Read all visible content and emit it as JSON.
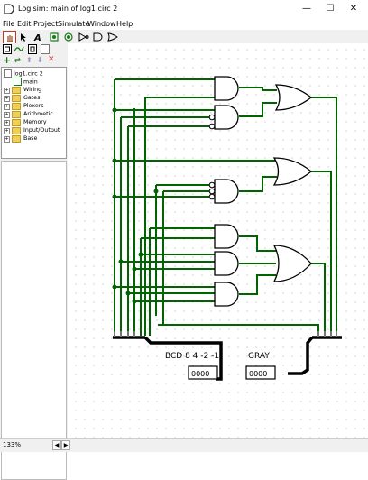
{
  "window": {
    "title": "Logisim: main of log1.circ 2",
    "minimize": "—",
    "maximize": "☐",
    "close": "✕"
  },
  "menu": [
    "File",
    "Edit",
    "Project",
    "Simulate",
    "Window",
    "Help"
  ],
  "project_tree": {
    "root": "log1.circ 2",
    "circuit": "main",
    "libraries": [
      "Wiring",
      "Gates",
      "Plexers",
      "Arithmetic",
      "Memory",
      "Input/Output",
      "Base"
    ]
  },
  "canvas": {
    "left_label": "BCD 8 4 -2 -1",
    "right_label": "GRAY",
    "left_pins": "0000",
    "right_pins": "0000"
  },
  "status": {
    "zoom": "133%"
  },
  "colors": {
    "wire_on": "#006400",
    "wire_bus": "#000000",
    "gate_stroke": "#000000",
    "accent": "#c0392b"
  }
}
